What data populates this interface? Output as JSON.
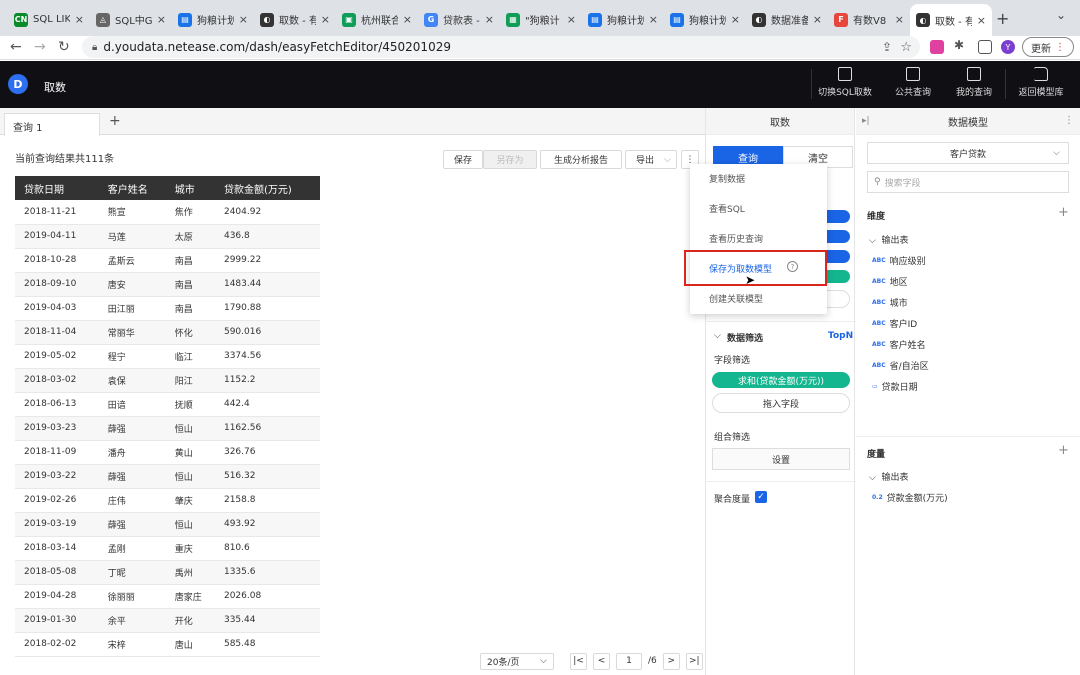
{
  "browser": {
    "tabs": [
      {
        "title": "SQL LIK",
        "fav": "CN",
        "color": "#0a8a2a"
      },
      {
        "title": "SQL中G",
        "fav": "◬",
        "color": "#666"
      },
      {
        "title": "狗粮计划",
        "fav": "▤",
        "color": "#1a73e8"
      },
      {
        "title": "取数 - 有",
        "fav": "◐",
        "color": "#333"
      },
      {
        "title": "杭州联合",
        "fav": "▣",
        "color": "#0f9d58"
      },
      {
        "title": "贷款表 -",
        "fav": "G",
        "color": "#4285f4"
      },
      {
        "title": "\"狗粮计",
        "fav": "▦",
        "color": "#0f9d58"
      },
      {
        "title": "狗粮计划",
        "fav": "▤",
        "color": "#1a73e8"
      },
      {
        "title": "狗粮计划",
        "fav": "▤",
        "color": "#1a73e8"
      },
      {
        "title": "数据准备",
        "fav": "◐",
        "color": "#333"
      },
      {
        "title": "有数V8",
        "fav": "F",
        "color": "#e8453c"
      },
      {
        "title": "取数 - 有",
        "fav": "◐",
        "color": "#333"
      }
    ],
    "url": "d.youdata.netease.com/dash/easyFetchEditor/450201029",
    "update_label": "更新",
    "profile_letter": "Y"
  },
  "app": {
    "title": "取数",
    "header_buttons": [
      "切换SQL取数",
      "公共查询",
      "我的查询",
      "返回模型库"
    ]
  },
  "query": {
    "tab_label": "查询 1",
    "result_count": "当前查询结果共111条",
    "toolbar": {
      "save": "保存",
      "save_as": "另存为",
      "report": "生成分析报告",
      "export": "导出"
    },
    "columns": [
      "贷款日期",
      "客户姓名",
      "城市",
      "贷款金额(万元)"
    ],
    "rows": [
      [
        "2018-11-21",
        "熊宣",
        "焦作",
        "2404.92"
      ],
      [
        "2019-04-11",
        "马莲",
        "太原",
        "436.8"
      ],
      [
        "2018-10-28",
        "孟斯云",
        "南昌",
        "2999.22"
      ],
      [
        "2018-09-10",
        "唐安",
        "南昌",
        "1483.44"
      ],
      [
        "2019-04-03",
        "田江丽",
        "南昌",
        "1790.88"
      ],
      [
        "2018-11-04",
        "常丽华",
        "怀化",
        "590.016"
      ],
      [
        "2019-05-02",
        "程宁",
        "临江",
        "3374.56"
      ],
      [
        "2018-03-02",
        "袁保",
        "阳江",
        "1152.2"
      ],
      [
        "2018-06-13",
        "田谙",
        "抚顺",
        "442.4"
      ],
      [
        "2019-03-23",
        "薛强",
        "恒山",
        "1162.56"
      ],
      [
        "2018-11-09",
        "潘舟",
        "黄山",
        "326.76"
      ],
      [
        "2019-03-22",
        "薛强",
        "恒山",
        "516.32"
      ],
      [
        "2019-02-26",
        "庄伟",
        "肇庆",
        "2158.8"
      ],
      [
        "2019-03-19",
        "薛强",
        "恒山",
        "493.92"
      ],
      [
        "2018-03-14",
        "孟刚",
        "重庆",
        "810.6"
      ],
      [
        "2018-05-08",
        "丁昵",
        "禹州",
        "1335.6"
      ],
      [
        "2019-04-28",
        "徐丽丽",
        "唐家庄",
        "2026.08"
      ],
      [
        "2019-01-30",
        "余平",
        "开化",
        "335.44"
      ],
      [
        "2018-02-02",
        "宋梓",
        "唐山",
        "585.48"
      ]
    ],
    "pager": {
      "page_size": "20条/页",
      "current": "1",
      "total": "/6"
    }
  },
  "dropdown": {
    "items": [
      "复制数据",
      "查看SQL",
      "查看历史查询",
      "保存为取数模型",
      "创建关联模型"
    ],
    "help": "?"
  },
  "mid": {
    "title": "取数",
    "query_btn": "查询",
    "clear_btn": "清空",
    "filter_title": "数据筛选",
    "topn": "TopN",
    "field_filter": "字段筛选",
    "green_field": "求和(贷款金额(万元))",
    "drag_field": "拖入字段",
    "combo_filter": "组合筛选",
    "settings": "设置",
    "aggregate": "聚合度量"
  },
  "right": {
    "title": "数据模型",
    "model": "客户贷款",
    "search_placeholder": "搜索字段",
    "dims_title": "维度",
    "dim_group": "输出表",
    "dims": [
      "响应级别",
      "地区",
      "城市",
      "客户ID",
      "客户姓名",
      "省/自治区",
      "贷款日期"
    ],
    "dim_type": "ABC",
    "measures_title": "度量",
    "measure_group": "输出表",
    "measures": [
      "贷款金额(万元)"
    ],
    "measure_type": "0.2"
  },
  "colors": {
    "accent": "#1a64e6",
    "green": "#13b68f",
    "highlight": "#d9271f"
  }
}
